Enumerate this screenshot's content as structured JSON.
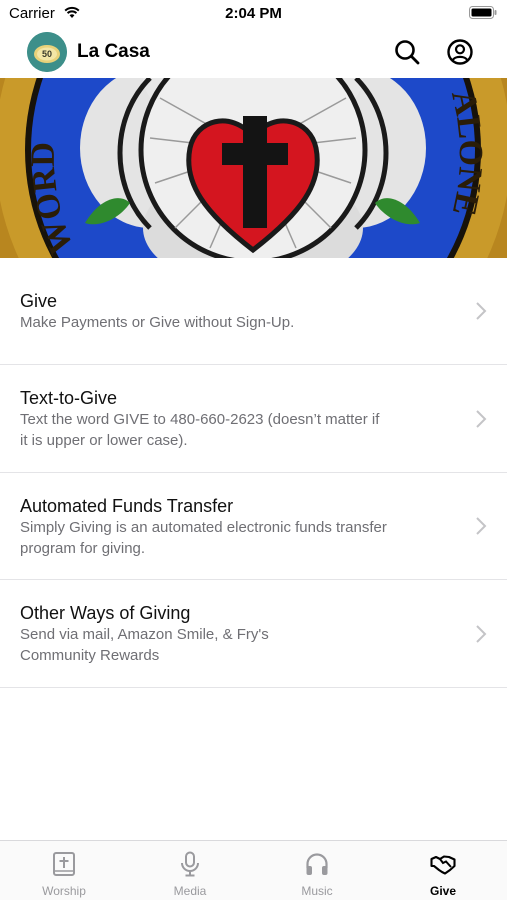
{
  "status_bar": {
    "carrier": "Carrier",
    "time": "2:04 PM"
  },
  "header": {
    "title": "La Casa",
    "logo_text": "50"
  },
  "banner": {
    "left_text": "WORD",
    "right_text": "ALONE"
  },
  "give_options": [
    {
      "title": "Give",
      "subtitle_lines": [
        "Make Payments or Give without Sign-Up."
      ]
    },
    {
      "title": "Text-to-Give",
      "subtitle_lines": [
        "Text the word GIVE to 480-660-2623 (doesn’t matter if",
        "it is upper or lower case)."
      ]
    },
    {
      "title": "Automated Funds Transfer",
      "subtitle_lines": [
        "Simply Giving is an automated electronic funds transfer",
        "program for giving."
      ]
    },
    {
      "title": "Other Ways of Giving",
      "subtitle_lines": [
        "Send via mail, Amazon Smile, & Fry's",
        "Community Rewards"
      ]
    }
  ],
  "tabs": [
    {
      "label": "Worship",
      "icon": "bible-icon",
      "active": false
    },
    {
      "label": "Media",
      "icon": "microphone-icon",
      "active": false
    },
    {
      "label": "Music",
      "icon": "headphones-icon",
      "active": false
    },
    {
      "label": "Give",
      "icon": "handshake-icon",
      "active": true
    }
  ],
  "colors": {
    "accent": "#000000",
    "inactive_tab": "#9a9a9e",
    "subtitle": "#6f6f74",
    "logo_bg": "#3d8f8a",
    "heart_red": "#d4151f"
  }
}
